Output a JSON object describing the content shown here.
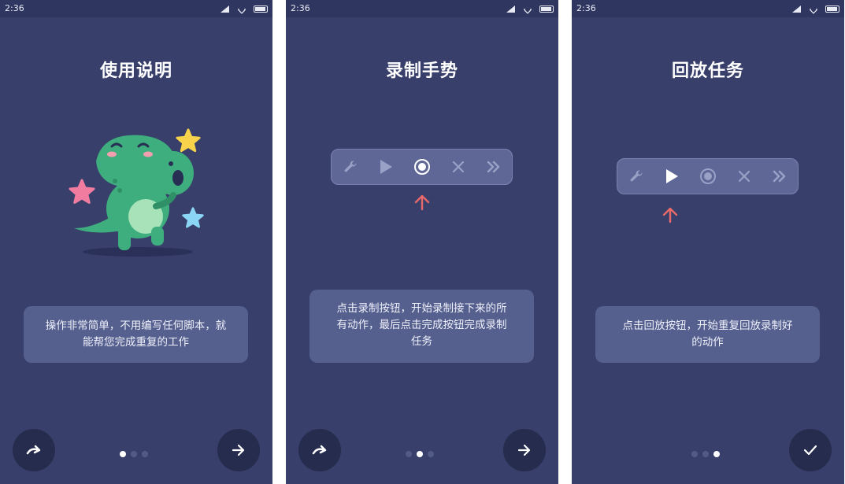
{
  "status_time": "2:36",
  "screens": [
    {
      "title": "使用说明",
      "desc_line1": "操作非常简单，不用编写任何脚本，就",
      "desc_line2": "能帮您完成重复的工作",
      "left_button": "skip-icon",
      "right_button": "arrow-right-icon",
      "active_page": 1
    },
    {
      "title": "录制手势",
      "desc_line1": "点击录制按钮，开始录制接下来的所",
      "desc_line2": "有动作，最后点击完成按钮完成录制",
      "desc_line3": "任务",
      "left_button": "skip-icon",
      "right_button": "arrow-right-icon",
      "active_page": 2,
      "highlighted_tool": "record"
    },
    {
      "title": "回放任务",
      "desc_line1": "点击回放按钮，开始重复回放录制好",
      "desc_line2": "的动作",
      "right_button": "check-icon",
      "active_page": 3,
      "highlighted_tool": "play"
    }
  ],
  "toolbar_icons": [
    "wrench-icon",
    "play-icon",
    "record-icon",
    "close-icon",
    "fast-forward-icon"
  ],
  "colors": {
    "background": "#383f6b",
    "statusbar": "#2f3660",
    "card": "#56608f",
    "button": "#262c4d",
    "arrow": "#e86a6a",
    "dino": "#3fae7e",
    "star_yellow": "#f7d24a",
    "star_pink": "#f07ca0",
    "star_blue": "#8cd6f5"
  }
}
